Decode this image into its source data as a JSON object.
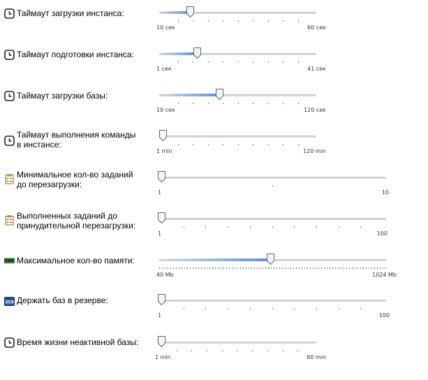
{
  "settings": [
    {
      "label": "Таймаут загрузки инстанса:",
      "icon": "clock-icon",
      "min_label": "10 сек",
      "max_label": "60 сек",
      "value_fraction": 0.18,
      "ticks": 9,
      "dense": false
    },
    {
      "label": "Таймаут подготовки инстанса:",
      "icon": "clock-icon",
      "min_label": "1 сек",
      "max_label": "41 сек",
      "value_fraction": 0.23,
      "ticks": 9,
      "dense": false
    },
    {
      "label": "Таймаут загрузки базы:",
      "icon": "clock-icon",
      "min_label": "10 сек",
      "max_label": "120 сек",
      "value_fraction": 0.38,
      "ticks": 9,
      "dense": false
    },
    {
      "label": "Таймаут выполнения команды\nв инстансе:",
      "icon": "clock-icon",
      "min_label": "1 min",
      "max_label": "120 min",
      "value_fraction": 0.0,
      "ticks": 9,
      "dense": false
    },
    {
      "label": "Минимальное кол-во заданий\nдо перезагрузки:",
      "icon": "checklist-icon",
      "min_label": "1",
      "max_label": "10",
      "value_fraction": 0.0,
      "ticks": 1,
      "dense": false
    },
    {
      "label": "Выполненных заданий до\nпринудительной перезагрузки:",
      "icon": "checklist-icon",
      "min_label": "1",
      "max_label": "100",
      "value_fraction": 0.0,
      "ticks": 9,
      "dense": false
    },
    {
      "label": "Максимальное кол-во памяти:",
      "icon": "memory-icon",
      "min_label": "40 Mb",
      "max_label": "1024 Mb",
      "value_fraction": 0.49,
      "ticks": 0,
      "dense": true
    },
    {
      "label": "Держать баз в резерве:",
      "icon": "counter-icon",
      "min_label": "1",
      "max_label": "100",
      "value_fraction": 0.0,
      "ticks": 9,
      "dense": false
    },
    {
      "label": "Время жизни неактивной базы:",
      "icon": "clock-icon",
      "min_label": "1 min",
      "max_label": "60 min",
      "value_fraction": 0.0,
      "ticks": 9,
      "dense": false
    }
  ]
}
